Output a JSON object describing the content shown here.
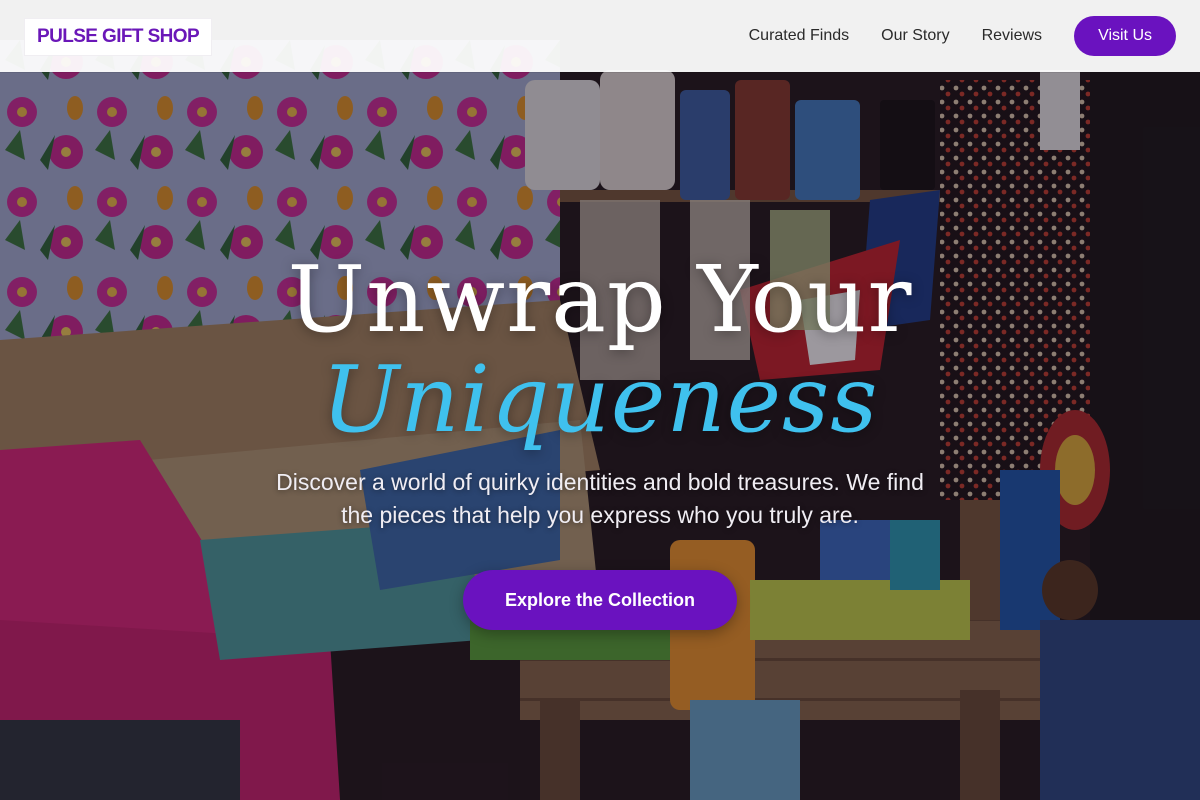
{
  "header": {
    "logo_text": "PULSE GIFT SHOP",
    "nav": [
      {
        "label": "Curated Finds"
      },
      {
        "label": "Our Story"
      },
      {
        "label": "Reviews"
      }
    ],
    "visit_button": "Visit Us"
  },
  "hero": {
    "title_line_1": "Unwrap Your",
    "title_line_2": "Uniqueness",
    "subtitle": "Discover a world of quirky identities and bold treasures. We find the pieces that help you express who you truly are.",
    "cta_label": "Explore the Collection",
    "background_image": "market stall with colorful souvenirs, floral fabric bags, necklaces and flags"
  },
  "colors": {
    "brand_purple": "#6a12bf",
    "accent_cyan": "#3fc1ee",
    "header_bg": "#ffffff"
  }
}
